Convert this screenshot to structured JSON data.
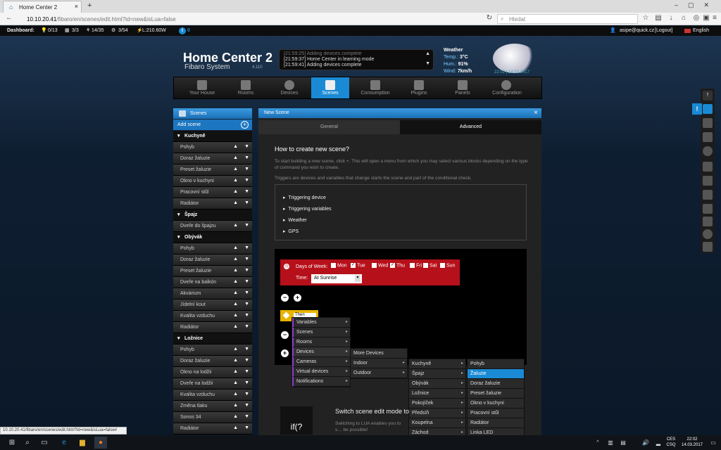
{
  "browser": {
    "tab_title": "Home Center 2",
    "url_host": "10.10.20.41",
    "url_path": "/fibaro/en/scenes/edit.html?id=new&isLua=false",
    "search_placeholder": "Hledat",
    "status_url": "10.10.20.41/fibaro/en/scenes/edit.html?id=new&isLua=false#"
  },
  "dashboard": {
    "label": "Dashboard:",
    "stats": [
      "0/13",
      "3/3",
      "14/35",
      "3/54",
      "L:210.60W"
    ],
    "notif_count": "0",
    "user": "asipe@quick.cz",
    "logout": "[Logout]",
    "language": "English"
  },
  "header": {
    "logo": "Home Center 2",
    "subtitle": "Fibaro System",
    "version": "4.110",
    "log_lines": [
      "[21:59:25] Adding devices complete",
      "[21:59:37] Home Center in learning mode",
      "[21:59:41] Adding devices complete"
    ],
    "weather": {
      "title": "Weather",
      "temp_label": "Temp.:",
      "temp": "3°C",
      "hum_label": "Hum.:",
      "hum": "91%",
      "wind_label": "Wind:",
      "wind": "7km/h",
      "time": "22:02 | 14.03.2017"
    }
  },
  "nav": {
    "items": [
      "Your House",
      "Rooms",
      "Devices",
      "Scenes",
      "Consumption",
      "Plugins",
      "Panels",
      "Configuration"
    ],
    "active": "Scenes"
  },
  "sidebar": {
    "title": "Scenes",
    "add_label": "Add scene",
    "groups": [
      {
        "name": "Kuchyně",
        "items": [
          "Pohyb",
          "Doraz žaluzie",
          "Preset žaluzie",
          "Okno v kuchyni",
          "Pracovní stůl",
          "Radiátor"
        ]
      },
      {
        "name": "Špajz",
        "items": [
          "Dveře do špajzu"
        ]
      },
      {
        "name": "Obývák",
        "items": [
          "Pohyb",
          "Doraz žaluzie",
          "Preset žaluzie",
          "Dveře na balkón",
          "Akvárium",
          "Jídelní kout",
          "Kvalita vzduchu",
          "Radiátor"
        ]
      },
      {
        "name": "Ložnice",
        "items": [
          "Pohyb",
          "Doraz žaluzie",
          "Okno na lodžii",
          "Dveře na lodžii",
          "Kvalita vzduchu",
          "Změna tlaku",
          "Sonos 34",
          "Radiátor"
        ]
      }
    ]
  },
  "panel": {
    "title": "New Scene",
    "tab_general": "General",
    "tab_advanced": "Advanced",
    "how_title": "How to create new scene?",
    "help1": "To start building a new scene, click +. This will open a menu from which you may select various blocks depending on the type of command you wish to create.",
    "help2": "Triggers are devices and variables that change starts the scene and part of the conditional check.",
    "triggers": [
      "Triggering device",
      "Triggering variables",
      "Weather",
      "GPS"
    ],
    "days_label": "Days of Week:",
    "days": [
      {
        "name": "Mon",
        "checked": false
      },
      {
        "name": "Tue",
        "checked": true
      },
      {
        "name": "Wed",
        "checked": false
      },
      {
        "name": "Thu",
        "checked": true
      },
      {
        "name": "Fri",
        "checked": false
      },
      {
        "name": "Sat",
        "checked": false
      },
      {
        "name": "Sun",
        "checked": false
      }
    ],
    "time_label": "Time:",
    "time_value": "At Sunrise",
    "then_value": "Then",
    "menu1": [
      "Variables",
      "Scenes",
      "Rooms",
      "Devices",
      "Cameras",
      "Virtual devices",
      "Notifications"
    ],
    "menu2": [
      "More Devices",
      "Indoor",
      "Outdoor"
    ],
    "menu3": [
      "Kuchyně",
      "Špajz",
      "Obývák",
      "Ložnice",
      "Pokojíček",
      "Předsíň",
      "Koupelna",
      "Záchod"
    ],
    "menu4": [
      "Pohyb",
      "Žaluzie",
      "Doraz žaluzie",
      "Preset žaluzie",
      "Okno v kuchyni",
      "Pracovní stůl",
      "Radiátor",
      "Linka LED"
    ],
    "lua_title": "Switch scene edit mode to",
    "lua_sub": "Switching to LUA enables you to s… be possible!",
    "lua_icon": "if(?"
  },
  "taskbar": {
    "lang": "CES",
    "lang2": "CSQ",
    "time": "22:02",
    "date": "14.03.2017"
  }
}
